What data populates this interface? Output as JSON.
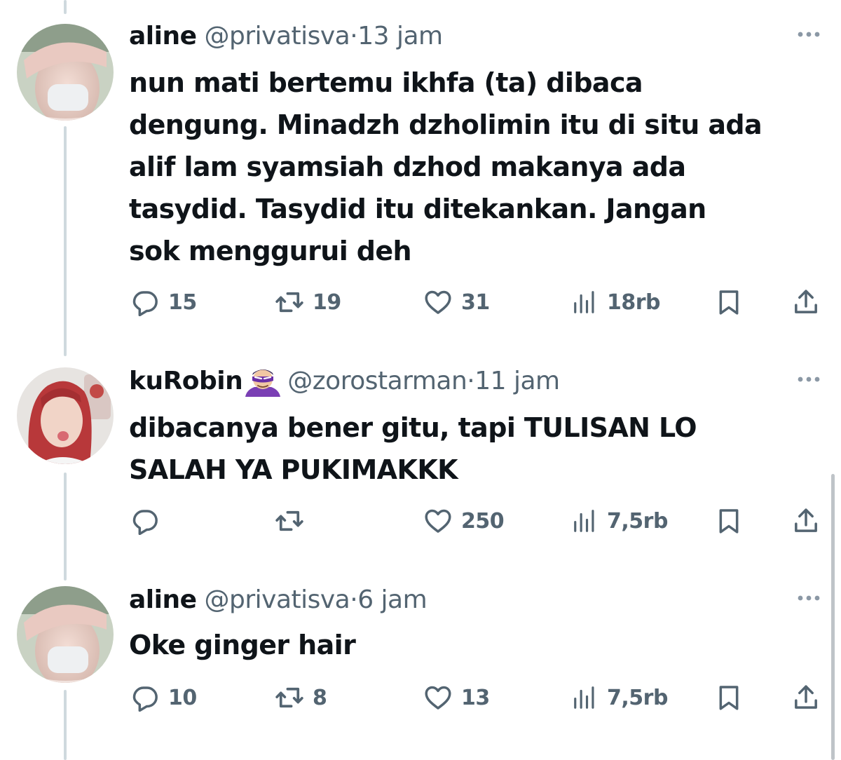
{
  "colors": {
    "text": "#0f1419",
    "secondary": "#536471",
    "thread_line": "#cfd9de",
    "background": "#ffffff"
  },
  "tweets": [
    {
      "display_name": "aline",
      "handle": "@privatisva",
      "separator": "·",
      "time": "13 jam",
      "emoji": "",
      "text": "nun mati bertemu ikhfa (ta) dibaca\ndengung. Minadzh dzholimin itu di situ ada\nalif lam syamsiah dzhod makanya ada\ntasydid. Tasydid itu ditekankan. Jangan\nsok menggurui deh",
      "replies": "15",
      "reposts": "19",
      "likes": "31",
      "views": "18rb",
      "icons": [
        "avatar",
        "more-icon",
        "reply-icon",
        "repost-icon",
        "like-icon",
        "views-icon",
        "bookmark-icon",
        "share-icon"
      ]
    },
    {
      "display_name": "kuRobin",
      "handle": "@zorostarman",
      "separator": "·",
      "time": "11 jam",
      "emoji": "ninja-emoji",
      "text": "dibacanya bener gitu, tapi TULISAN LO\nSALAH YA PUKIMAKKK",
      "replies": "",
      "reposts": "",
      "likes": "250",
      "views": "7,5rb",
      "icons": [
        "avatar",
        "more-icon",
        "reply-icon",
        "repost-icon",
        "like-icon",
        "views-icon",
        "bookmark-icon",
        "share-icon"
      ]
    },
    {
      "display_name": "aline",
      "handle": "@privatisva",
      "separator": "·",
      "time": "6 jam",
      "emoji": "",
      "text": "Oke ginger hair",
      "replies": "10",
      "reposts": "8",
      "likes": "13",
      "views": "7,5rb",
      "icons": [
        "avatar",
        "more-icon",
        "reply-icon",
        "repost-icon",
        "like-icon",
        "views-icon",
        "bookmark-icon",
        "share-icon"
      ]
    }
  ]
}
